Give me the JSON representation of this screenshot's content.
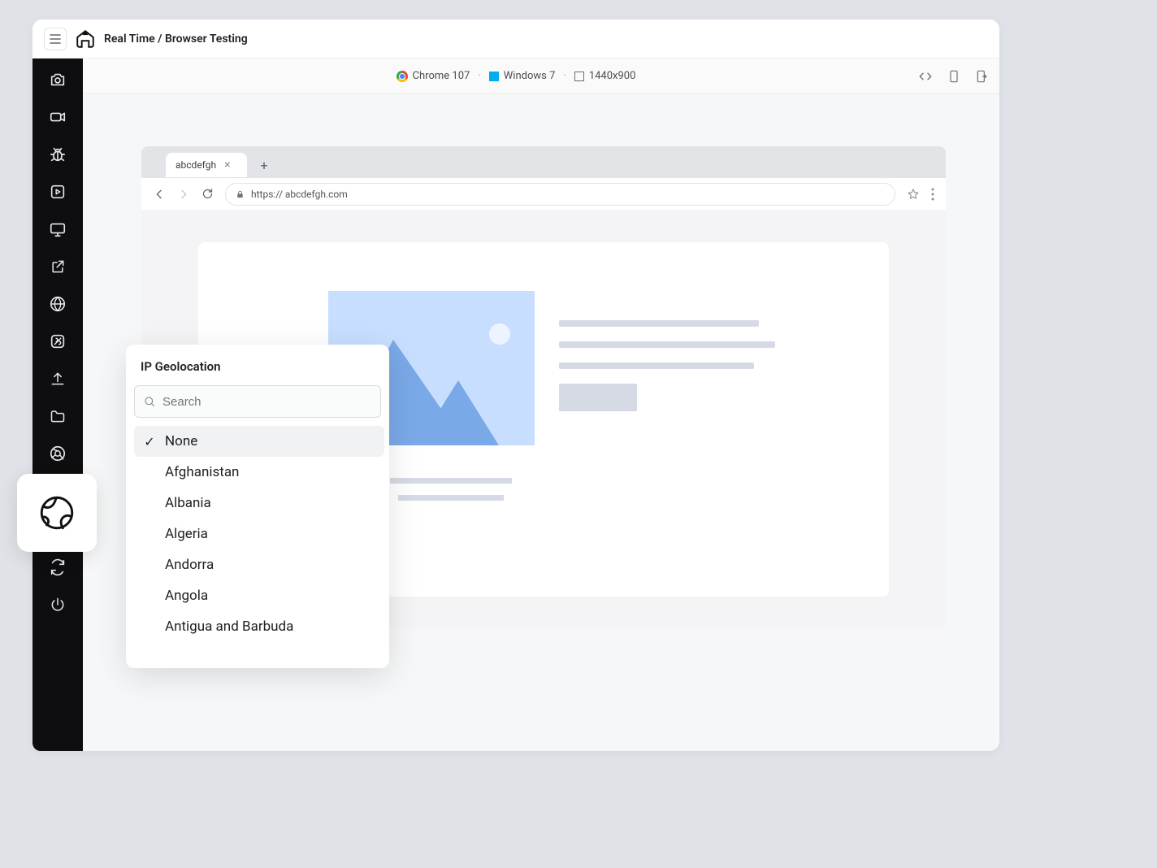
{
  "header": {
    "title": "Real Time / Browser Testing"
  },
  "env": {
    "browser": "Chrome 107",
    "os": "Windows 7",
    "resolution": "1440x900"
  },
  "tab": {
    "label": "abcdefgh",
    "url": "https:// abcdefgh.com"
  },
  "popover": {
    "title": "IP Geolocation",
    "search_placeholder": "Search",
    "options": [
      "None",
      "Afghanistan",
      "Albania",
      "Algeria",
      "Andorra",
      "Angola",
      "Antigua and Barbuda"
    ],
    "selected_index": 0
  }
}
